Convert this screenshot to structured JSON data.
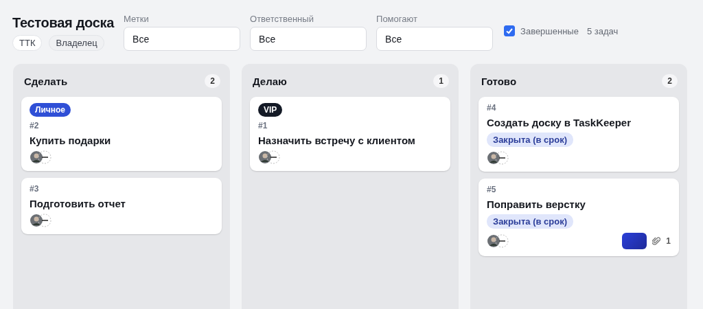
{
  "board": {
    "title": "Тестовая доска",
    "chips": [
      "ТТК",
      "Владелец"
    ]
  },
  "filters": [
    {
      "label": "Метки",
      "value": "Все"
    },
    {
      "label": "Ответственный",
      "value": "Все"
    },
    {
      "label": "Помогают",
      "value": "Все"
    }
  ],
  "completed": {
    "label": "Завершенные",
    "checked": true
  },
  "task_count": "5 задач",
  "columns": [
    {
      "title": "Сделать",
      "count": "2",
      "cards": [
        {
          "tags": [
            {
              "label": "Личное",
              "color": "#2f4fd6"
            }
          ],
          "number": "#2",
          "title": "Купить подарки"
        },
        {
          "number": "#3",
          "title": "Подготовить отчет"
        }
      ]
    },
    {
      "title": "Делаю",
      "count": "1",
      "cards": [
        {
          "tags": [
            {
              "label": "VIP",
              "color": "#141a26"
            }
          ],
          "number": "#1",
          "title": "Назначить встречу с клиентом"
        }
      ]
    },
    {
      "title": "Готово",
      "count": "2",
      "cards": [
        {
          "number": "#4",
          "title": "Создать доску в TaskKeeper",
          "statuses": [
            "Закрыта (в срок)"
          ]
        },
        {
          "number": "#5",
          "title": "Поправить верстку",
          "statuses": [
            "Закрыта (в срок)"
          ],
          "attachment_preview": true,
          "attachments": "1"
        }
      ]
    }
  ]
}
